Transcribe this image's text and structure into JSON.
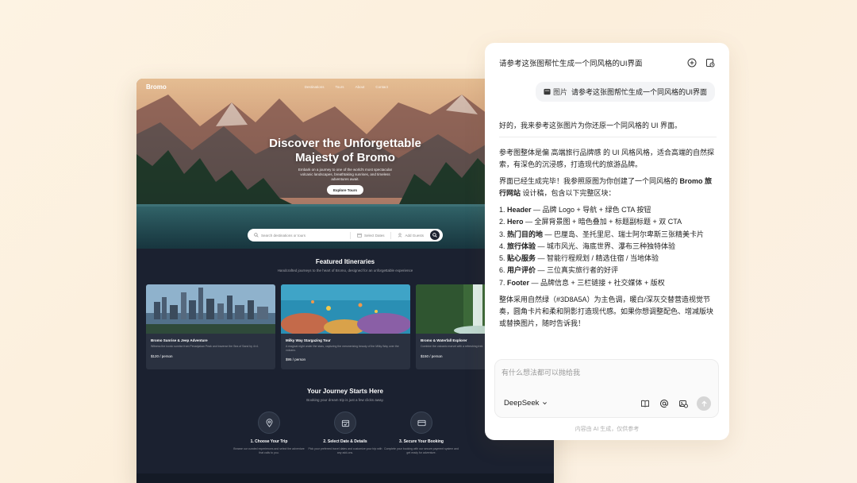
{
  "site": {
    "logo": "Bromo",
    "nav": [
      "Destinations",
      "Tours",
      "About",
      "Contact"
    ],
    "hero": {
      "title_line1": "Discover the Unforgettable",
      "title_line2": "Majesty of Bromo",
      "subtitle": "Embark on a journey to one of the world's most spectacular volcanic landscapes, breathtaking sunrises, and timeless adventures await.",
      "cta": "Explore Tours"
    },
    "search": {
      "placeholder": "Search destinations or tours",
      "dates": "Select Dates",
      "guests": "Add Guests"
    },
    "featured": {
      "title": "Featured Itineraries",
      "subtitle": "Handcrafted journeys to the heart of Bromo, designed for an unforgettable experience",
      "cards": [
        {
          "name": "Bromo Sunrise & Jeep Adventure",
          "desc": "Witness the iconic sunrise from Penanjakan Peak and traverse the Sea of Sand by 4×4.",
          "price": "$120 / person"
        },
        {
          "name": "Milky Way Stargazing Tour",
          "desc": "A magical night under the stars, capturing the mesmerizing beauty of the Milky Way over the volcano.",
          "price": "$95 / person"
        },
        {
          "name": "Bromo & Waterfall Explorer",
          "desc": "Combine the volcanic marvel with a refreshing trek",
          "price": "$150 / person"
        }
      ]
    },
    "journey": {
      "title": "Your Journey Starts Here",
      "subtitle": "Booking your dream trip is just a few clicks away.",
      "steps": [
        {
          "name": "1. Choose Your Trip",
          "desc": "Browse our curated experiences and select the adventure that calls to you."
        },
        {
          "name": "2. Select Date & Details",
          "desc": "Pick your preferred travel dates and customize your trip with any add-ons."
        },
        {
          "name": "3. Secure Your Booking",
          "desc": "Complete your booking with our secure payment system and get ready for adventure."
        }
      ]
    }
  },
  "chat": {
    "title": "请参考这张图帮忙生成一个同风格的UI界面",
    "user_message": {
      "attachment": "图片",
      "text": "请参考这张图帮忙生成一个同风格的UI界面"
    },
    "answer": {
      "intro": "好的，我来参考这张图片为你还原一个同风格的 UI 界面。",
      "p1": "参考图整体是偏 高端旅行品牌感 的 UI 风格风格，适合高端的自然探索，有深色的沉浸感，打造现代的旅游品牌。",
      "p2_a": "界面已经生成完毕！我参照原图为你创建了一个同风格的 ",
      "p2_b": "Bromo 旅行网站",
      "p2_c": " 设计稿，包含以下完整区块：",
      "list": [
        {
          "n": "1. ",
          "k": "Header",
          "v": " — 品牌 Logo + 导航 + 绿色 CTA 按钮"
        },
        {
          "n": "2. ",
          "k": "Hero",
          "v": " — 全屏背景图 + 暗色叠加 + 标题副标题 + 双 CTA"
        },
        {
          "n": "3. ",
          "k": "热门目的地",
          "v": " — 巴厘岛、圣托里尼、瑞士阿尔卑斯三张精美卡片"
        },
        {
          "n": "4. ",
          "k": "旅行体验",
          "v": " — 城市风光、海底世界、瀑布三种独特体验"
        },
        {
          "n": "5. ",
          "k": "贴心服务",
          "v": " — 智能行程规划 / 精选住宿 / 当地体验"
        },
        {
          "n": "6. ",
          "k": "用户评价",
          "v": " — 三位真实旅行者的好评"
        },
        {
          "n": "7. ",
          "k": "Footer",
          "v": " — 品牌信息 + 三栏链接 + 社交媒体 + 版权"
        }
      ],
      "closing": "整体采用自然绿（#3D8A5A）为主色调，暖白/深灰交替营造视觉节奏，圆角卡片和柔和阴影打造现代感。如果你想调整配色、增减版块或替换图片，随时告诉我！"
    },
    "composer": {
      "placeholder": "有什么想法都可以抛给我",
      "model": "DeepSeek"
    },
    "disclaimer": "内容由 AI 生成，仅供参考"
  },
  "colors": {
    "accent_green": "#3D8A5A",
    "site_bg": "#1b2130",
    "page_bg": "#fdf3e3"
  }
}
